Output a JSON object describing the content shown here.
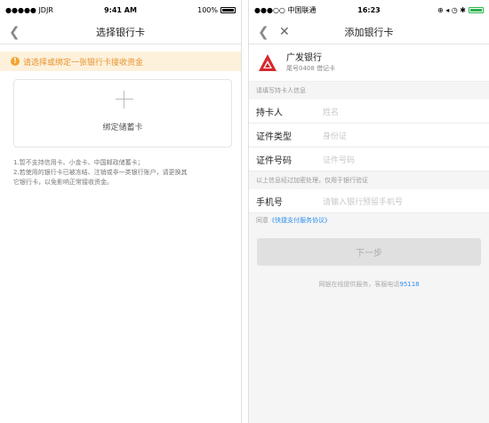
{
  "left": {
    "status": {
      "carrier": "●●●●● JDJR",
      "time": "9:41 AM",
      "battery": "100%"
    },
    "nav": {
      "back_icon": "chevron-left-icon",
      "title": "选择银行卡"
    },
    "notice": {
      "icon": "info-icon",
      "text": "请选择或绑定一张银行卡接收资金"
    },
    "bind": {
      "label": "绑定储蓄卡"
    },
    "tips": {
      "line1": "1.暂不支持信用卡、小金卡、中国邮政储蓄卡；",
      "line2": "2.若使用的银行卡已被冻结、注销或非一类银行账户，请更换其",
      "line3": "它银行卡，以免影响正常接收资金。"
    }
  },
  "right": {
    "status": {
      "carrier": "●●●○○ 中国联通",
      "time": "16:23",
      "icons": "⊕ ◂ ◷ ✱"
    },
    "nav": {
      "title": "添加银行卡"
    },
    "bank": {
      "name": "广发银行",
      "sub": "尾号0408 借记卡",
      "color": "#d8272e"
    },
    "section1": "请填写持卡人信息",
    "fields": [
      {
        "label": "持卡人",
        "placeholder": "姓名"
      },
      {
        "label": "证件类型",
        "placeholder": "身份证"
      },
      {
        "label": "证件号码",
        "placeholder": "证件号码"
      }
    ],
    "section2": "以上信息经过加密处理，仅用于银行验证",
    "phone_field": {
      "label": "手机号",
      "placeholder": "请输入银行预留手机号"
    },
    "agree": {
      "prefix": "同意",
      "link": "《快捷支付服务协议》"
    },
    "next_button": "下一步",
    "service": {
      "text": "网银在线提供服务，客服电话",
      "phone": "95118"
    }
  }
}
